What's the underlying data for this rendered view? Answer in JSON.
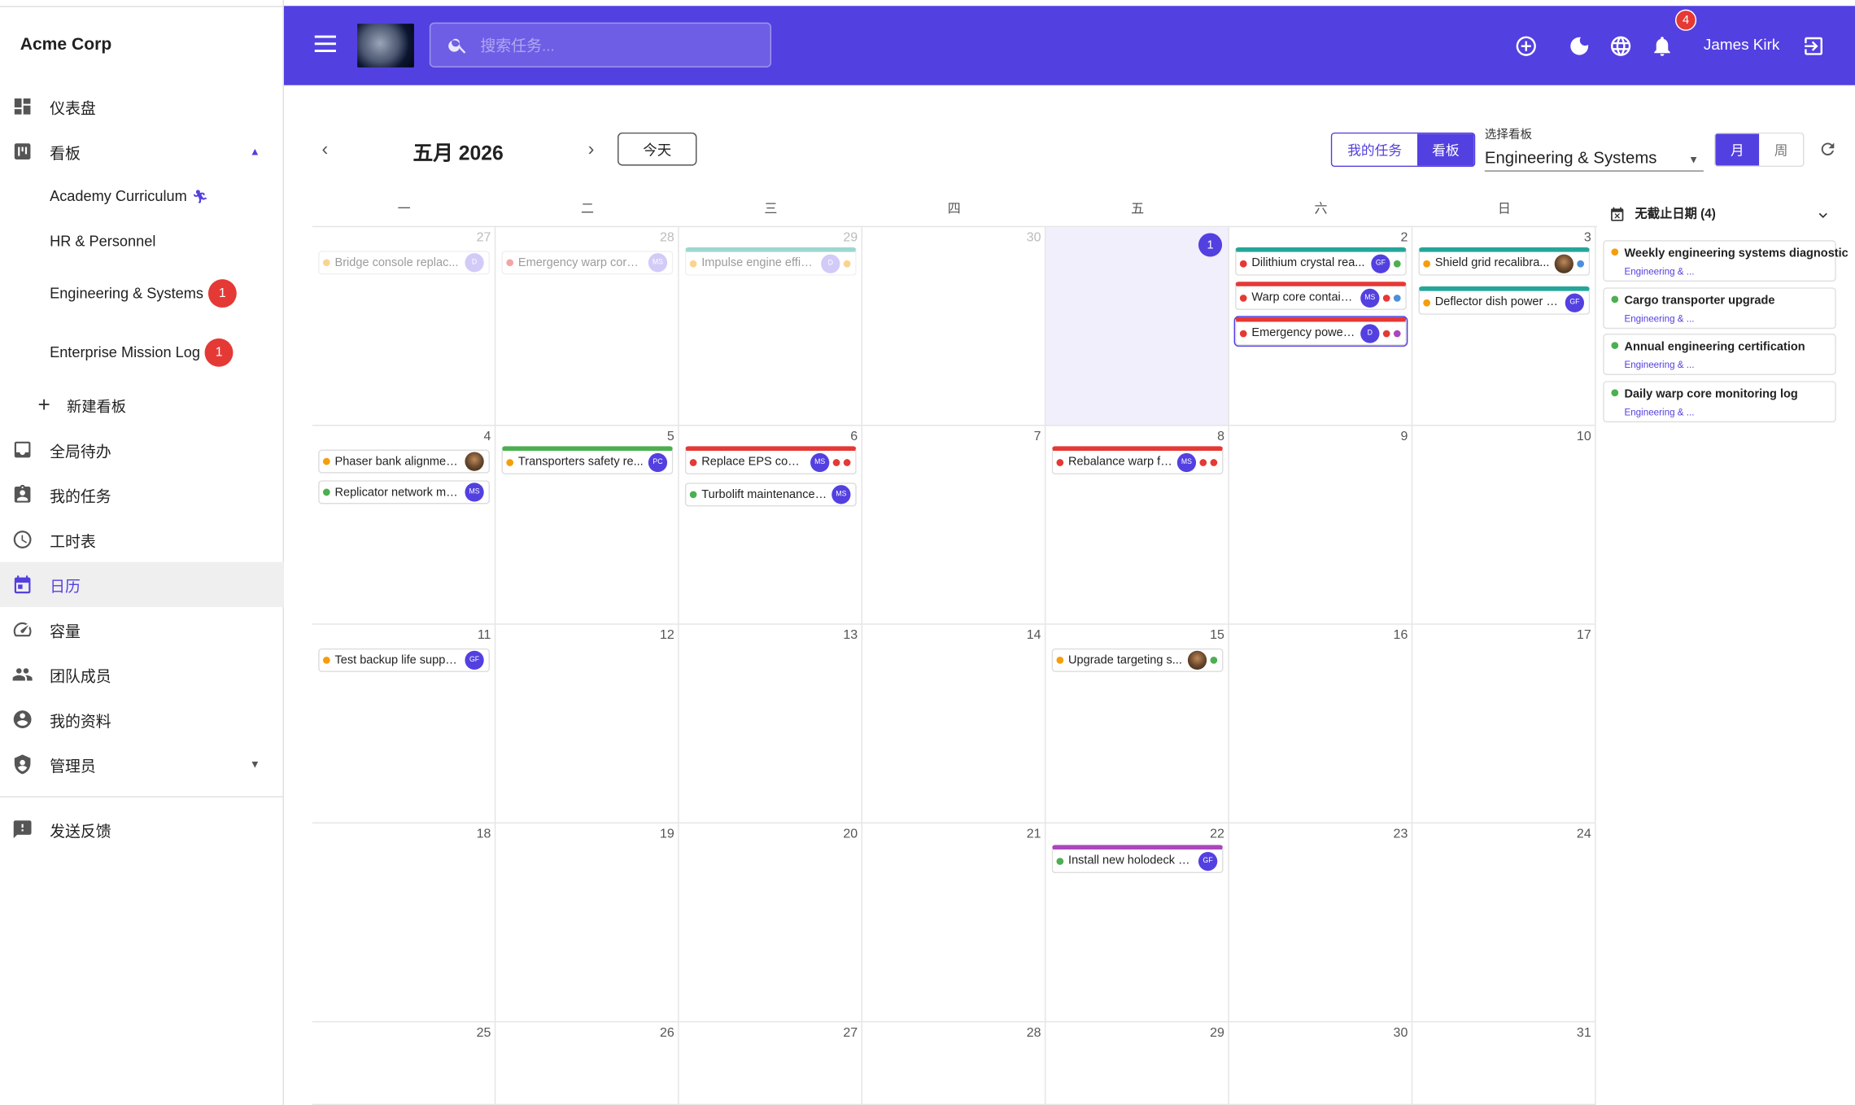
{
  "app": {
    "brand": "Acme Corp",
    "user": "James Kirk",
    "notifications": "4"
  },
  "search": {
    "placeholder": "搜索任务..."
  },
  "sidebar": {
    "dashboard": "仪表盘",
    "boards": "看板",
    "board_items": [
      {
        "label": "Academy Curriculum",
        "badge": ""
      },
      {
        "label": "HR & Personnel",
        "badge": ""
      },
      {
        "label": "Engineering & Systems",
        "badge": "1"
      },
      {
        "label": "Enterprise Mission Log",
        "badge": "1"
      }
    ],
    "new_board": "新建看板",
    "inbox": "全局待办",
    "my_tasks": "我的任务",
    "timesheet": "工时表",
    "calendar": "日历",
    "capacity": "容量",
    "team": "团队成员",
    "profile": "我的资料",
    "admin": "管理员",
    "feedback": "发送反馈"
  },
  "toolbar": {
    "month_title": "五月 2026",
    "today": "今天",
    "my_tasks_toggle": "我的任务",
    "board_toggle": "看板",
    "board_select_label": "选择看板",
    "board_select_value": "Engineering & Systems",
    "month_view": "月",
    "week_view": "周"
  },
  "weekdays": [
    "一",
    "二",
    "三",
    "四",
    "五",
    "六",
    "日"
  ],
  "days": [
    "27",
    "28",
    "29",
    "30",
    "1",
    "2",
    "3",
    "4",
    "5",
    "6",
    "7",
    "8",
    "9",
    "10",
    "11",
    "12",
    "13",
    "14",
    "15",
    "16",
    "17",
    "18",
    "19",
    "20",
    "21",
    "22",
    "23",
    "24",
    "25",
    "26",
    "27",
    "28",
    "29",
    "30",
    "31"
  ],
  "events": [
    {
      "title": "Bridge console replac...",
      "initials": "D"
    },
    {
      "title": "Emergency warp core ...",
      "initials": "MS"
    },
    {
      "title": "Impulse engine effic...",
      "initials": "D"
    },
    {
      "title": "Dilithium crystal rea...",
      "initials": "GF"
    },
    {
      "title": "Warp core contain...",
      "initials": "MS"
    },
    {
      "title": "Emergency power ...",
      "initials": "D"
    },
    {
      "title": "Shield grid recalibra...",
      "initials": ""
    },
    {
      "title": "Deflector dish power c...",
      "initials": "GF"
    },
    {
      "title": "Phaser bank alignmen...",
      "initials": ""
    },
    {
      "title": "Replicator network ma...",
      "initials": "MS"
    },
    {
      "title": "Transporters safety re...",
      "initials": "PC"
    },
    {
      "title": "Replace EPS cond...",
      "initials": "MS"
    },
    {
      "title": "Turbolift maintenance ...",
      "initials": "MS"
    },
    {
      "title": "Rebalance warp fi...",
      "initials": "MS"
    },
    {
      "title": "Test backup life suppo...",
      "initials": "GF"
    },
    {
      "title": "Upgrade targeting s...",
      "initials": ""
    },
    {
      "title": "Install new holodeck p...",
      "initials": "GF"
    }
  ],
  "no_due": {
    "title": "无截止日期 (4)",
    "items": [
      {
        "title": "Weekly engineering systems diagnostic",
        "board": "Engineering & ..."
      },
      {
        "title": "Cargo transporter upgrade",
        "board": "Engineering & ..."
      },
      {
        "title": "Annual engineering certification",
        "board": "Engineering & ..."
      },
      {
        "title": "Daily warp core monitoring log",
        "board": "Engineering & ..."
      }
    ]
  },
  "colors": {
    "primary": "#5340e0",
    "red": "#e53935",
    "orange": "#f59e0b",
    "green": "#4caf50",
    "teal": "#26a69a",
    "purple": "#ab47bc",
    "blue": "#4a90d9"
  },
  "icons": [
    "menu-icon",
    "search-icon",
    "add-circle-icon",
    "dark-mode-icon",
    "globe-icon",
    "bell-icon",
    "logout-icon",
    "refresh-icon",
    "calendar-x-icon",
    "chevron-down-icon"
  ]
}
